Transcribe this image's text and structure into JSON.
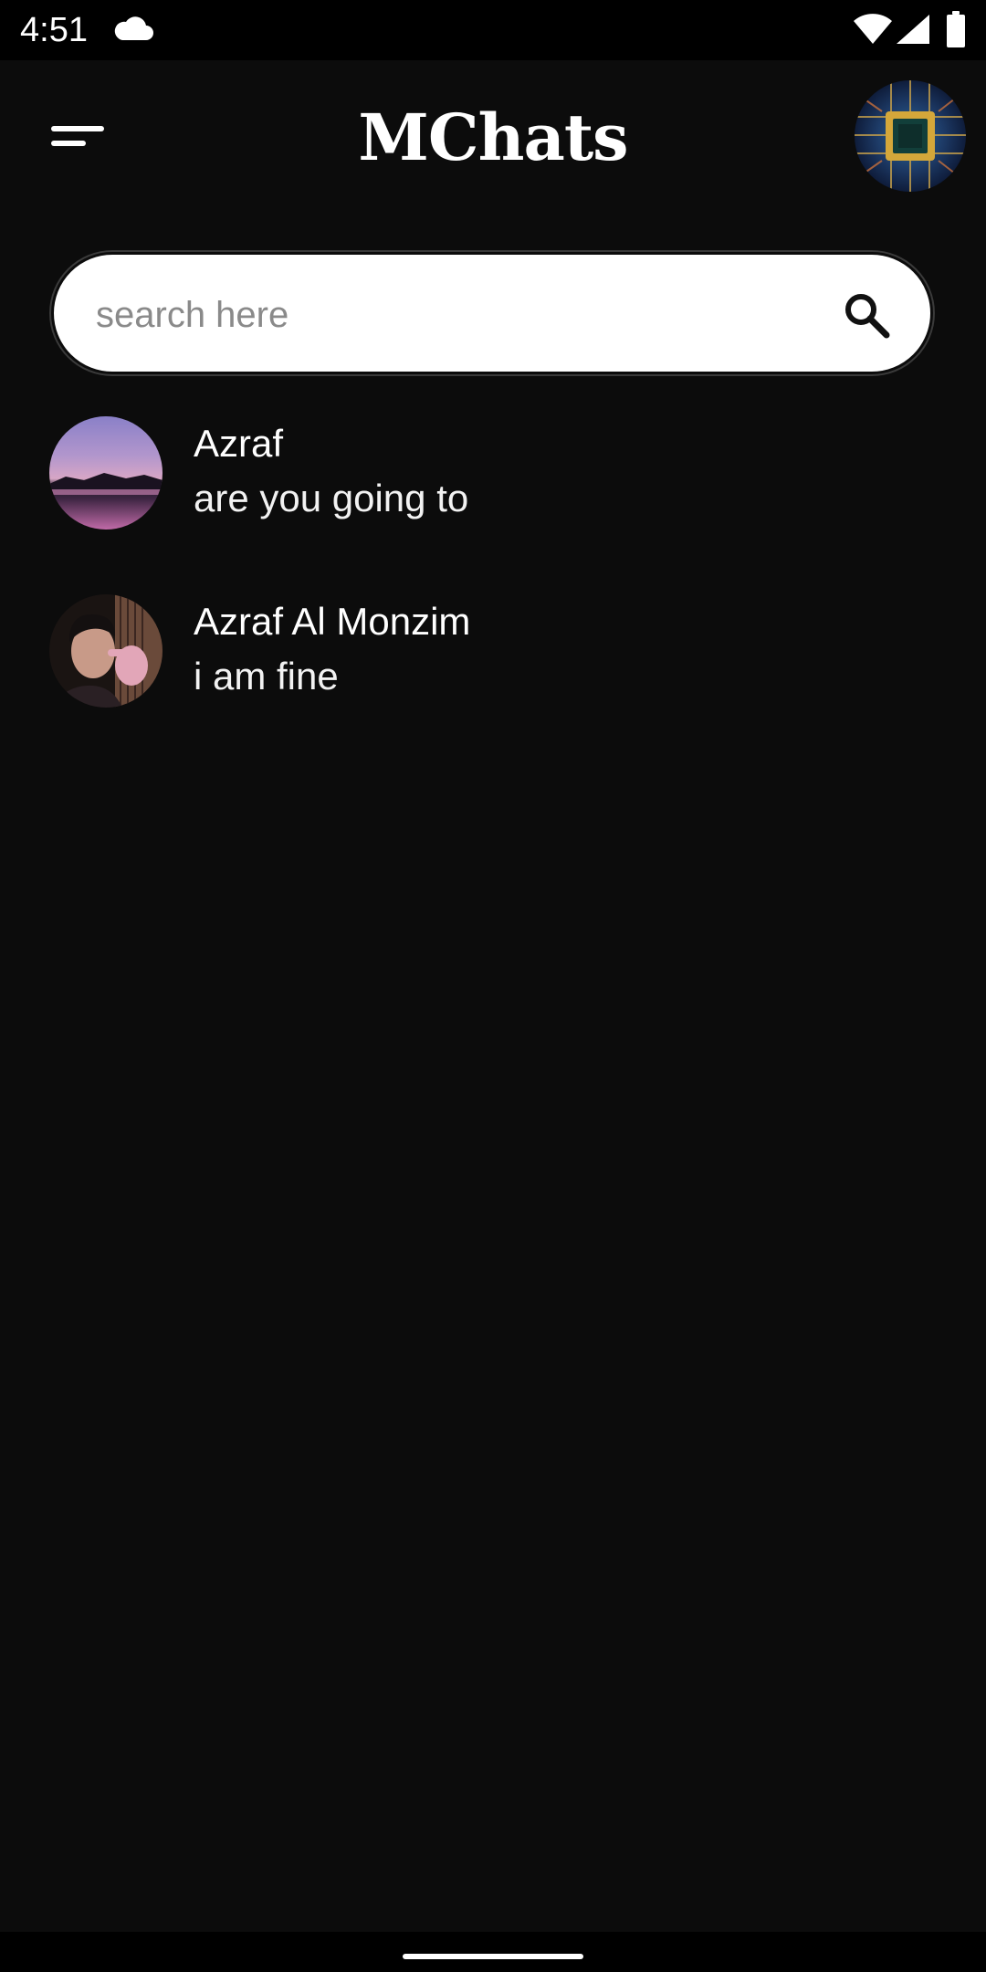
{
  "status_bar": {
    "time": "4:51",
    "icons": [
      "cloud-icon",
      "wifi-icon",
      "cellular-signal-icon",
      "battery-icon"
    ]
  },
  "app_bar": {
    "title": "MChats",
    "menu_icon": "menu-icon",
    "profile_icon": "profile-avatar"
  },
  "search": {
    "placeholder": "search here",
    "value": "",
    "icon": "search-icon"
  },
  "chats": [
    {
      "name": "Azraf",
      "last_message": "are you going to",
      "avatar": "twilight-lake-landscape"
    },
    {
      "name": "Azraf Al Monzim",
      "last_message": "i am fine",
      "avatar": "selfie-portrait"
    }
  ],
  "colors": {
    "background": "#0c0c0c",
    "status_bar": "#000000",
    "text": "#ffffff",
    "search_background": "#ffffff",
    "placeholder": "#8a8a8a"
  }
}
